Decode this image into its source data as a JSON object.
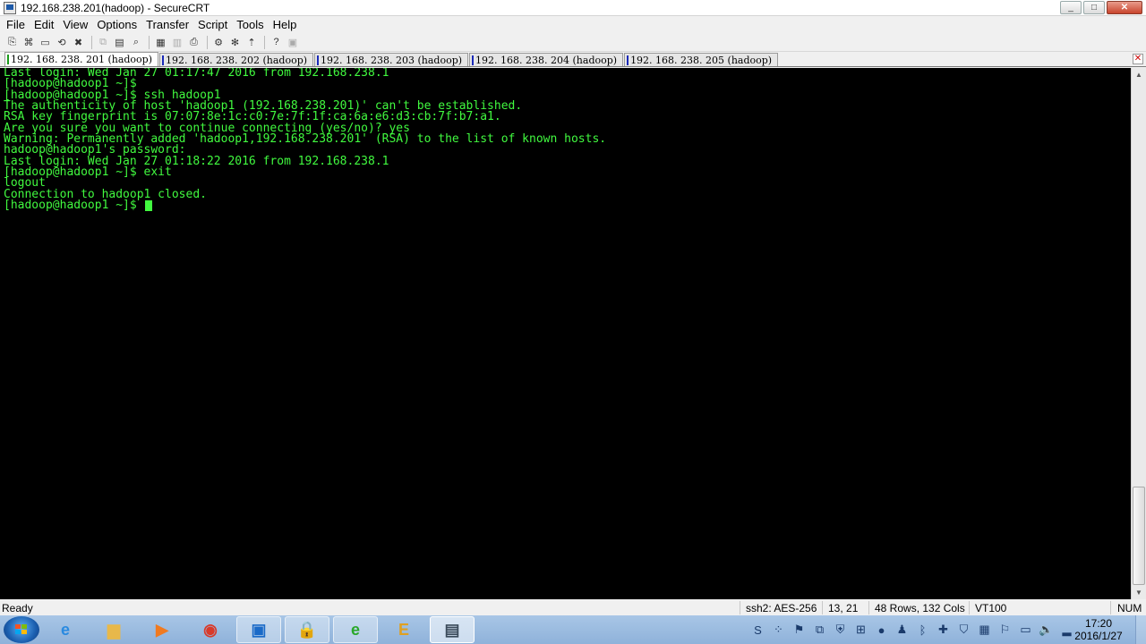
{
  "window": {
    "title": "192.168.238.201(hadoop) - SecureCRT",
    "controls": [
      "_",
      "□",
      "✕"
    ]
  },
  "menu": [
    "File",
    "Edit",
    "View",
    "Options",
    "Transfer",
    "Script",
    "Tools",
    "Help"
  ],
  "toolbar": {
    "buttons": [
      {
        "icon": "connect-icon",
        "glyph": "⎘"
      },
      {
        "icon": "quick-connect-icon",
        "glyph": "⌘"
      },
      {
        "icon": "connect-in-tab-icon",
        "glyph": "▭"
      },
      {
        "icon": "reconnect-icon",
        "glyph": "⟲"
      },
      {
        "icon": "disconnect-icon",
        "glyph": "✖"
      },
      {
        "icon": "copy-icon",
        "glyph": "⧉"
      },
      {
        "icon": "paste-icon",
        "glyph": "▤"
      },
      {
        "icon": "find-icon",
        "glyph": "⌕"
      },
      {
        "icon": "print-setup-icon",
        "glyph": "▦"
      },
      {
        "icon": "print-selection-icon",
        "glyph": "▥"
      },
      {
        "icon": "print-icon",
        "glyph": "⎙"
      },
      {
        "icon": "session-options-icon",
        "glyph": "⚙"
      },
      {
        "icon": "global-options-icon",
        "glyph": "✻"
      },
      {
        "icon": "sftp-icon",
        "glyph": "⇡"
      },
      {
        "icon": "help-icon",
        "glyph": "?"
      },
      {
        "icon": "map-keys-icon",
        "glyph": "▣"
      }
    ]
  },
  "tabs": [
    {
      "label": "192. 168. 238. 201 (hadoop)",
      "active": true
    },
    {
      "label": "192. 168. 238. 202 (hadoop)",
      "active": false
    },
    {
      "label": "192. 168. 238. 203 (hadoop)",
      "active": false
    },
    {
      "label": "192. 168. 238. 204 (hadoop)",
      "active": false
    },
    {
      "label": "192. 168. 238. 205 (hadoop)",
      "active": false
    }
  ],
  "terminal": {
    "lines": [
      "Last login: Wed Jan 27 01:17:47 2016 from 192.168.238.1",
      "[hadoop@hadoop1 ~]$",
      "[hadoop@hadoop1 ~]$ ssh hadoop1",
      "The authenticity of host 'hadoop1 (192.168.238.201)' can't be established.",
      "RSA key fingerprint is 07:07:8e:1c:c0:7e:7f:1f:ca:6a:e6:d3:cb:7f:b7:a1.",
      "Are you sure you want to continue connecting (yes/no)? yes",
      "Warning: Permanently added 'hadoop1,192.168.238.201' (RSA) to the list of known hosts.",
      "hadoop@hadoop1's password:",
      "Last login: Wed Jan 27 01:18:22 2016 from 192.168.238.1",
      "[hadoop@hadoop1 ~]$ exit",
      "logout",
      "Connection to hadoop1 closed."
    ],
    "prompt": "[hadoop@hadoop1 ~]$ ",
    "text_color": "#41f93f",
    "background": "#000000"
  },
  "status": {
    "left": "Ready",
    "cipher": "ssh2: AES-256",
    "cursor_pos": "13,  21",
    "size": "48 Rows, 132 Cols",
    "emulation": "VT100",
    "numlock": "NUM"
  },
  "taskbar": {
    "apps": [
      {
        "name": "ie-icon",
        "glyph": "e",
        "color": "#2a8ae0",
        "state": "normal"
      },
      {
        "name": "explorer-icon",
        "glyph": "▆",
        "color": "#e8b84a",
        "state": "normal"
      },
      {
        "name": "media-player-icon",
        "glyph": "▶",
        "color": "#f07a20",
        "state": "normal"
      },
      {
        "name": "chrome-icon",
        "glyph": "◉",
        "color": "#d93a2a",
        "state": "normal"
      },
      {
        "name": "vmware-icon",
        "glyph": "▣",
        "color": "#1a6ac8",
        "state": "running"
      },
      {
        "name": "securecrt-key-icon",
        "glyph": "🔒",
        "color": "#555555",
        "state": "running"
      },
      {
        "name": "green-browser-icon",
        "glyph": "e",
        "color": "#2aa82a",
        "state": "running"
      },
      {
        "name": "everything-icon",
        "glyph": "E",
        "color": "#e0a020",
        "state": "normal"
      },
      {
        "name": "securecrt-icon",
        "glyph": "▤",
        "color": "#3a4a5a",
        "state": "active"
      }
    ],
    "tray": [
      {
        "name": "sogou-input-icon",
        "glyph": "S"
      },
      {
        "name": "tray-dots-icon",
        "glyph": "⁘"
      },
      {
        "name": "red-flag-icon",
        "glyph": "⚑"
      },
      {
        "name": "copy-tray-icon",
        "glyph": "⧉"
      },
      {
        "name": "shield-tray-icon",
        "glyph": "⛨"
      },
      {
        "name": "windows-tray-icon",
        "glyph": "⊞"
      },
      {
        "name": "yellow-ball-icon",
        "glyph": "●"
      },
      {
        "name": "qq-icon",
        "glyph": "♟"
      },
      {
        "name": "bluetooth-icon",
        "glyph": "ᛒ"
      },
      {
        "name": "plus-icon",
        "glyph": "✚"
      },
      {
        "name": "security-icon",
        "glyph": "⛉"
      },
      {
        "name": "network-monitor-icon",
        "glyph": "▦"
      },
      {
        "name": "action-center-icon",
        "glyph": "⚐"
      },
      {
        "name": "display-icon",
        "glyph": "▭"
      },
      {
        "name": "volume-icon",
        "glyph": "🔈"
      },
      {
        "name": "signal-icon",
        "glyph": "▂"
      }
    ],
    "time": "17:20",
    "date": "2016/1/27"
  }
}
